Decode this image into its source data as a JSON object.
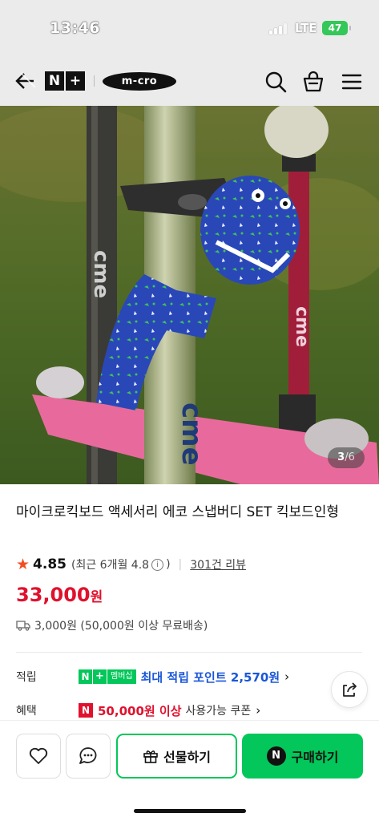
{
  "status_bar": {
    "time": "13:46",
    "network": "LTE",
    "battery": "47"
  },
  "nav": {
    "brand_logo_text": "N+",
    "seller_logo_text": "m-cro",
    "icons": [
      "back-icon",
      "search-icon",
      "cart-icon",
      "menu-icon"
    ]
  },
  "gallery": {
    "current": "3",
    "separator": "/",
    "total": "6"
  },
  "product": {
    "title": "마이크로킥보드 액세서리 에코 스냅버디 SET 킥보드인형",
    "rating": "4.85",
    "rating_recent_prefix": "(최근 6개월 4.8",
    "rating_recent_suffix": ")",
    "review_count": "301건 리뷰",
    "price_number": "33,000",
    "price_unit": "원",
    "shipping": "3,000원 (50,000원 이상 무료배송)"
  },
  "benefits": {
    "points_label": "적립",
    "member_badge": "멤버십",
    "points_text": "최대 적립 포인트 2,570원",
    "coupon_label": "혜택",
    "coupon_strong": "50,000원 이상",
    "coupon_rest": "사용가능 쿠폰"
  },
  "actions": {
    "gift_label": "선물하기",
    "buy_label": "구매하기"
  },
  "colors": {
    "naver_green": "#03c75a",
    "price_red": "#e0112d",
    "point_blue": "#1a56d8",
    "star_orange": "#f04e23"
  }
}
